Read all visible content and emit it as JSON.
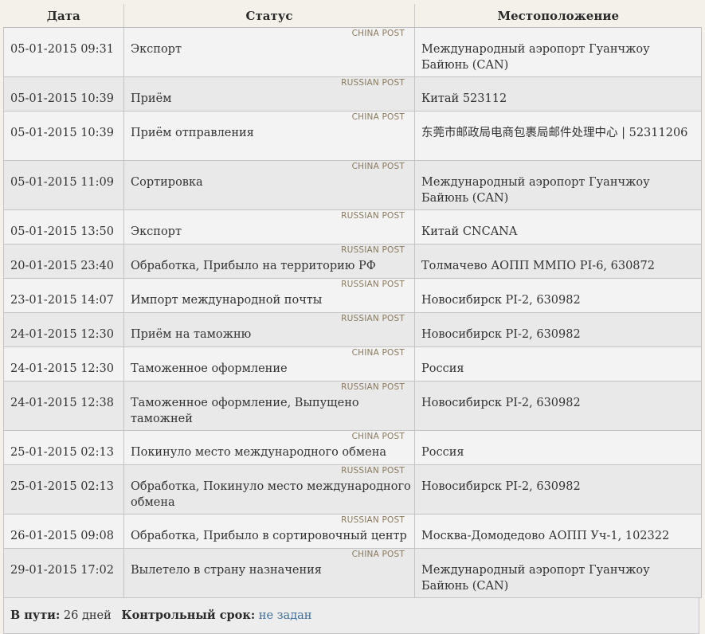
{
  "table": {
    "headers": {
      "date": "Дата",
      "status": "Статус",
      "location": "Местоположение"
    },
    "rows": [
      {
        "source": "CHINA POST",
        "date": "05-01-2015 09:31",
        "status": "Экспорт",
        "location": "Международный аэропорт Гуанчжоу Байюнь (CAN)"
      },
      {
        "source": "RUSSIAN POST",
        "date": "05-01-2015 10:39",
        "status": "Приём",
        "location": "Китай 523112"
      },
      {
        "source": "CHINA POST",
        "date": "05-01-2015 10:39",
        "status": "Приём отправления",
        "location": "东莞市邮政局电商包裹局邮件处理中心 | 52311206"
      },
      {
        "source": "CHINA POST",
        "date": "05-01-2015 11:09",
        "status": "Сортировка",
        "location": "Международный аэропорт Гуанчжоу Байюнь (CAN)"
      },
      {
        "source": "RUSSIAN POST",
        "date": "05-01-2015 13:50",
        "status": "Экспорт",
        "location": "Китай CNCANA"
      },
      {
        "source": "RUSSIAN POST",
        "date": "20-01-2015 23:40",
        "status": "Обработка, Прибыло на территорию РФ",
        "location": "Толмачево АОПП ММПО PI-6, 630872"
      },
      {
        "source": "RUSSIAN POST",
        "date": "23-01-2015 14:07",
        "status": "Импорт международной почты",
        "location": "Новосибирск PI-2, 630982"
      },
      {
        "source": "RUSSIAN POST",
        "date": "24-01-2015 12:30",
        "status": "Приём на таможню",
        "location": "Новосибирск PI-2, 630982"
      },
      {
        "source": "CHINA POST",
        "date": "24-01-2015 12:30",
        "status": "Таможенное оформление",
        "location": "Россия"
      },
      {
        "source": "RUSSIAN POST",
        "date": "24-01-2015 12:38",
        "status": "Таможенное оформление, Выпущено таможней",
        "location": "Новосибирск PI-2, 630982"
      },
      {
        "source": "CHINA POST",
        "date": "25-01-2015 02:13",
        "status": "Покинуло место международного обмена",
        "location": "Россия"
      },
      {
        "source": "RUSSIAN POST",
        "date": "25-01-2015 02:13",
        "status": "Обработка, Покинуло место международного обмена",
        "location": "Новосибирск PI-2, 630982"
      },
      {
        "source": "RUSSIAN POST",
        "date": "26-01-2015 09:08",
        "status": "Обработка, Прибыло в сортировочный центр",
        "location": "Москва-Домодедово АОПП Уч-1, 102322"
      },
      {
        "source": "CHINA POST",
        "date": "29-01-2015 17:02",
        "status": "Вылетело в страну назначения",
        "location": "Международный аэропорт Гуанчжоу Байюнь (CAN)"
      }
    ]
  },
  "footer": {
    "in_transit_label": "В пути:",
    "in_transit_value": "26 дней",
    "deadline_label": "Контрольный срок:",
    "deadline_value": "не задан"
  }
}
